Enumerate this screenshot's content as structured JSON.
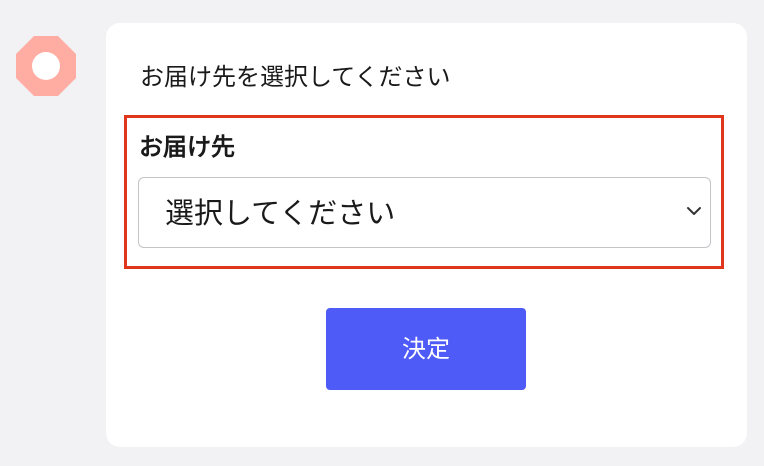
{
  "colors": {
    "accent": "#4e5bf7",
    "highlight_border": "#e0361b",
    "avatar": "#ffada2"
  },
  "avatar": {
    "icon": "avatar-ring-icon"
  },
  "message": {
    "prompt": "お届け先を選択してください"
  },
  "form": {
    "label": "お届け先",
    "select": {
      "value": "選択してください",
      "icon": "chevron-down-icon"
    },
    "submit_label": "決定"
  }
}
